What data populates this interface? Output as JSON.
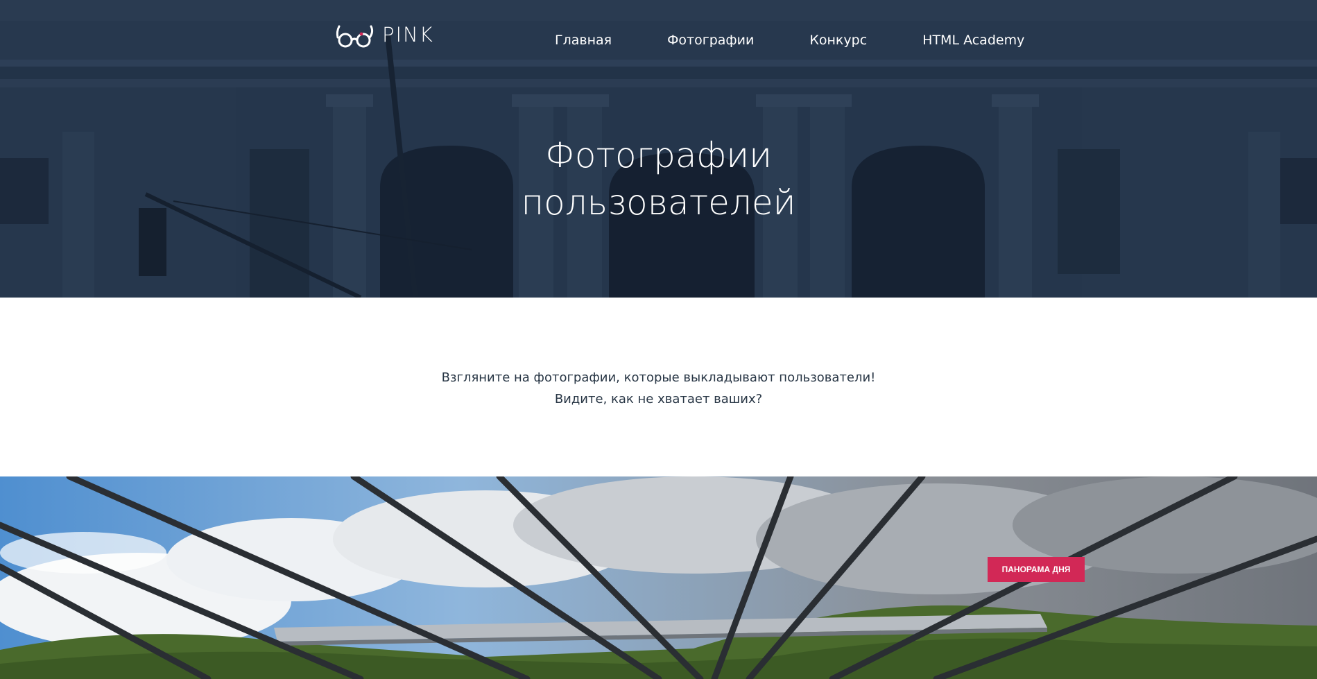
{
  "header": {
    "logo_text": "PINK",
    "logo_icon": "glasses-icon",
    "nav": [
      {
        "label": "Главная"
      },
      {
        "label": "Фотографии"
      },
      {
        "label": "Конкурс"
      },
      {
        "label": "HTML Academy"
      }
    ]
  },
  "hero": {
    "title_line1": "Фотографии",
    "title_line2": "пользователей",
    "background": "new-york-public-library-facade-photo"
  },
  "intro": {
    "line1": "Взгляните на фотографии, которые выкладывают пользователи!",
    "line2": "Видите, как не хватает ваших?"
  },
  "panorama": {
    "badge_label": "ПАНОРАМА ДНЯ",
    "background": "suspension-bridge-mountains-photo"
  },
  "colors": {
    "hero_overlay": "#1e2f44",
    "accent": "#d22856",
    "text_dark": "#283645"
  }
}
